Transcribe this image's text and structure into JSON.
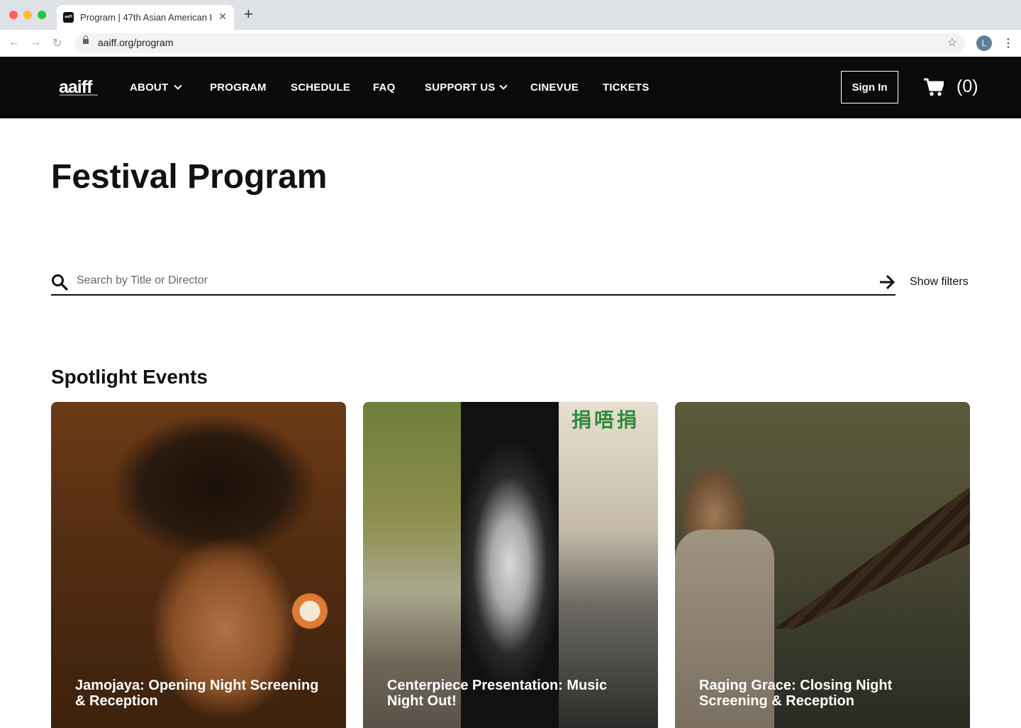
{
  "browser": {
    "tab_title": "Program | 47th Asian American F",
    "url": "aaiff.org/program",
    "profile_initial": "L"
  },
  "header": {
    "logo": "aaiff",
    "nav": [
      "ABOUT",
      "PROGRAM",
      "SCHEDULE",
      "FAQ",
      "SUPPORT US",
      "CINEVUE",
      "TICKETS"
    ],
    "sign_in": "Sign In",
    "cart_count": "(0)"
  },
  "main": {
    "title": "Festival Program",
    "search_placeholder": "Search by Title or Director",
    "show_filters": "Show filters",
    "spotlight_title": "Spotlight Events",
    "cards": [
      {
        "title": "Jamojaya: Opening Night Screening & Reception"
      },
      {
        "title": "Centerpiece Presentation: Music Night Out!",
        "sign_text": "捐唔捐"
      },
      {
        "title": "Raging Grace: Closing Night Screening & Reception"
      }
    ]
  },
  "icons": [
    "back-icon",
    "forward-icon",
    "reload-icon",
    "lock-icon",
    "star-icon",
    "menu-icon",
    "search-icon",
    "arrow-right-icon",
    "cart-icon",
    "chevron-down-icon"
  ]
}
